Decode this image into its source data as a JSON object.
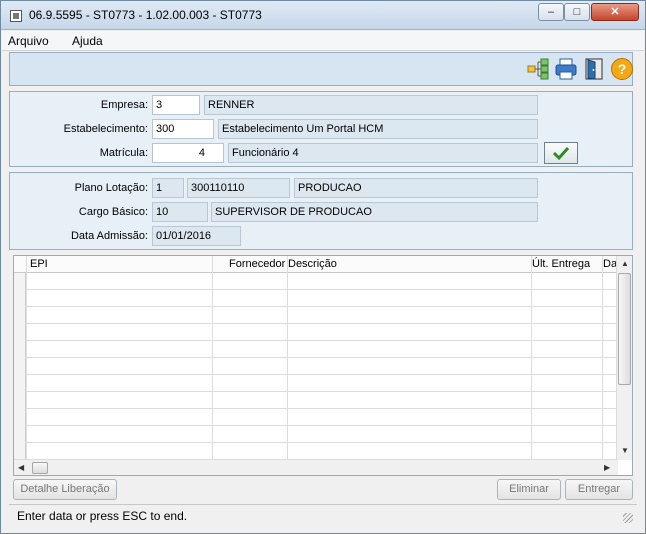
{
  "window": {
    "title": "06.9.5595 - ST0773 - 1.02.00.003 - ST0773",
    "min": "–",
    "max": "□",
    "close": "✕"
  },
  "menu": {
    "items": [
      "Arquivo",
      "Ajuda"
    ]
  },
  "toolbar": {
    "icons": [
      "tree-icon",
      "printer-icon",
      "exit-door-icon",
      "help-icon"
    ]
  },
  "form": {
    "empresa": {
      "label": "Empresa:",
      "code": "3",
      "desc": "RENNER"
    },
    "estabelecimento": {
      "label": "Estabelecimento:",
      "code": "300",
      "desc": "Estabelecimento Um Portal HCM"
    },
    "matricula": {
      "label": "Matrícula:",
      "code": "4",
      "desc": "Funcionário 4"
    }
  },
  "info": {
    "plano": {
      "label": "Plano Lotação:",
      "code": "1",
      "value": "300110110",
      "desc": "PRODUCAO"
    },
    "cargo": {
      "label": "Cargo Básico:",
      "code": "10",
      "desc": "SUPERVISOR DE PRODUCAO"
    },
    "admissao": {
      "label": "Data Admissão:",
      "value": "01/01/2016"
    }
  },
  "grid": {
    "columns": [
      "EPI",
      "Fornecedor",
      "Descrição",
      "Últ. Entrega",
      "Da"
    ],
    "rows": 11
  },
  "buttons": {
    "detalhe": "Detalhe Liberação",
    "eliminar": "Eliminar",
    "entregar": "Entregar"
  },
  "status": {
    "text": "Enter data or press ESC to end."
  },
  "colors": {
    "accent": "#d6e5f1",
    "panel": "#e7f0f7",
    "check": "#2e8b1e"
  }
}
